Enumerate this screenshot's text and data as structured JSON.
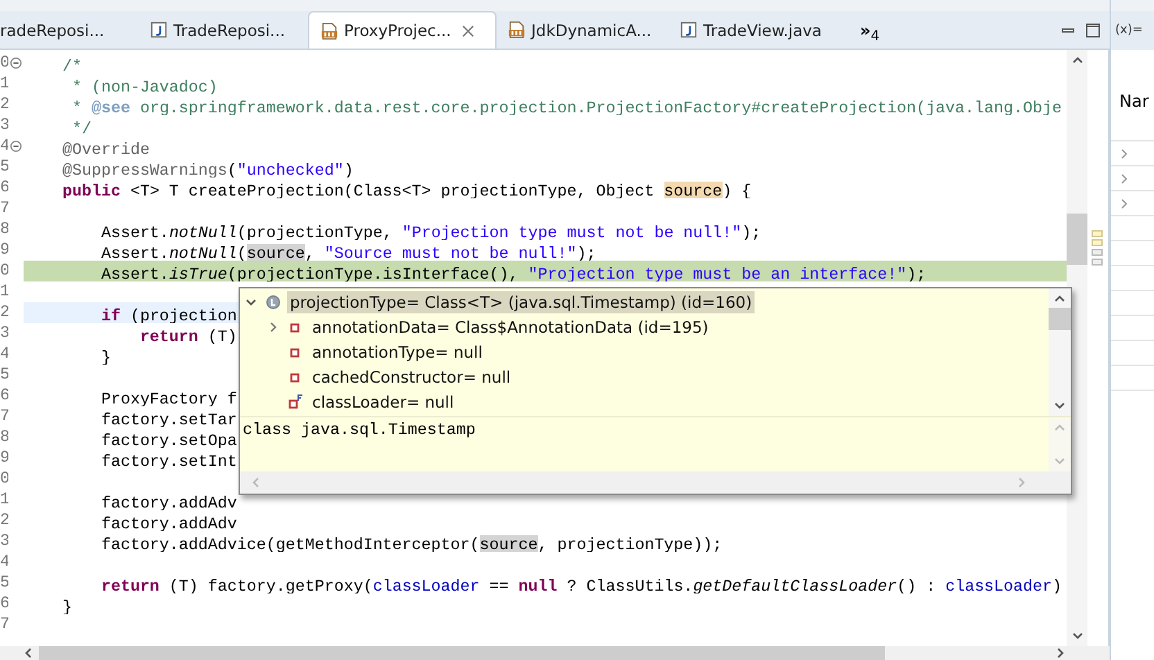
{
  "editor_tabs": [
    {
      "label": "radeReposi...",
      "kind": "cut",
      "selected": false,
      "closable": false
    },
    {
      "label": "TradeReposi...",
      "kind": "java",
      "selected": false,
      "closable": false
    },
    {
      "label": "ProxyProjec...",
      "kind": "class",
      "selected": true,
      "closable": true
    },
    {
      "label": "JdkDynamicA...",
      "kind": "class",
      "selected": false,
      "closable": false
    },
    {
      "label": "TradeView.java",
      "kind": "java",
      "selected": false,
      "closable": false
    }
  ],
  "overflow_tabs": {
    "mark": "»",
    "count": "4"
  },
  "code_lines": [
    {
      "num": "0",
      "fold": true,
      "kind": "code",
      "tokens": [
        {
          "text": "    /*",
          "kind": "comment"
        }
      ]
    },
    {
      "num": "1",
      "fold": false,
      "kind": "code",
      "tokens": [
        {
          "text": "     * (non-Javadoc)",
          "kind": "comment"
        }
      ]
    },
    {
      "num": "2",
      "fold": false,
      "kind": "code",
      "tokens": [
        {
          "text": "     * ",
          "kind": "comment"
        },
        {
          "text": "@see",
          "kind": "tag"
        },
        {
          "text": " org.springframework.data.rest.core.projection.ProjectionFactory#createProjection(java.lang.Obje",
          "kind": "comment"
        }
      ]
    },
    {
      "num": "3",
      "fold": false,
      "kind": "code",
      "tokens": [
        {
          "text": "     */",
          "kind": "comment"
        }
      ]
    },
    {
      "num": "4",
      "fold": true,
      "kind": "code",
      "tokens": [
        {
          "text": "    @Override",
          "kind": "annot"
        }
      ]
    },
    {
      "num": "5",
      "fold": false,
      "kind": "code",
      "tokens": [
        {
          "text": "    @SuppressWarnings",
          "kind": "annot"
        },
        {
          "text": "(",
          "kind": "plain"
        },
        {
          "text": "\"unchecked\"",
          "kind": "str"
        },
        {
          "text": ")",
          "kind": "plain"
        }
      ]
    },
    {
      "num": "6",
      "fold": false,
      "kind": "code",
      "tokens": [
        {
          "text": "    public",
          "kind": "kw"
        },
        {
          "text": " <T> T createProjection(Class<T> projectionType, Object ",
          "kind": "plain"
        },
        {
          "text": "source",
          "kind": "decl"
        },
        {
          "text": ") {",
          "kind": "plain"
        }
      ]
    },
    {
      "num": "7",
      "fold": false,
      "kind": "code"
    },
    {
      "num": "8",
      "fold": false,
      "kind": "code",
      "tokens": [
        {
          "text": "        Assert.",
          "kind": "plain"
        },
        {
          "text": "notNull",
          "kind": "italic"
        },
        {
          "text": "(projectionType, ",
          "kind": "plain"
        },
        {
          "text": "\"Projection type must not be null!\"",
          "kind": "str"
        },
        {
          "text": ");",
          "kind": "plain"
        }
      ]
    },
    {
      "num": "9",
      "fold": false,
      "kind": "code",
      "tokens": [
        {
          "text": "        Assert.",
          "kind": "plain"
        },
        {
          "text": "notNull",
          "kind": "italic"
        },
        {
          "text": "(",
          "kind": "plain"
        },
        {
          "text": "source",
          "kind": "occ"
        },
        {
          "text": ", ",
          "kind": "plain"
        },
        {
          "text": "\"Source must not be null!\"",
          "kind": "str"
        },
        {
          "text": ");",
          "kind": "plain"
        }
      ]
    },
    {
      "num": "0",
      "fold": false,
      "kind": "debug",
      "tokens": [
        {
          "text": "        Assert.",
          "kind": "plain"
        },
        {
          "text": "isTrue",
          "kind": "italic"
        },
        {
          "text": "(projectionType.isInterface(), ",
          "kind": "plain"
        },
        {
          "text": "\"Projection type must be an interface!\"",
          "kind": "str"
        },
        {
          "text": ");",
          "kind": "plain"
        }
      ]
    },
    {
      "num": "1",
      "fold": false,
      "kind": "code"
    },
    {
      "num": "2",
      "fold": false,
      "kind": "cursor",
      "tokens": [
        {
          "text": "        if",
          "kind": "kw"
        },
        {
          "text": " (projection",
          "kind": "plain"
        }
      ]
    },
    {
      "num": "3",
      "fold": false,
      "kind": "code",
      "tokens": [
        {
          "text": "            return",
          "kind": "kw"
        },
        {
          "text": " (T)",
          "kind": "plain"
        }
      ]
    },
    {
      "num": "4",
      "fold": false,
      "kind": "code",
      "tokens": [
        {
          "text": "        }",
          "kind": "plain"
        }
      ]
    },
    {
      "num": "5",
      "fold": false,
      "kind": "code"
    },
    {
      "num": "6",
      "fold": false,
      "kind": "code",
      "tokens": [
        {
          "text": "        ProxyFactory f",
          "kind": "plain"
        }
      ]
    },
    {
      "num": "7",
      "fold": false,
      "kind": "code",
      "tokens": [
        {
          "text": "        factory.setTar",
          "kind": "plain"
        }
      ]
    },
    {
      "num": "8",
      "fold": false,
      "kind": "code",
      "tokens": [
        {
          "text": "        factory.setOpa",
          "kind": "plain"
        }
      ]
    },
    {
      "num": "9",
      "fold": false,
      "kind": "code",
      "tokens": [
        {
          "text": "        factory.setInt",
          "kind": "plain"
        }
      ]
    },
    {
      "num": "0",
      "fold": false,
      "kind": "code"
    },
    {
      "num": "1",
      "fold": false,
      "kind": "code",
      "tokens": [
        {
          "text": "        factory.addAdv",
          "kind": "plain"
        }
      ]
    },
    {
      "num": "2",
      "fold": false,
      "kind": "code",
      "tokens": [
        {
          "text": "        factory.addAdv",
          "kind": "plain"
        }
      ]
    },
    {
      "num": "3",
      "fold": false,
      "kind": "code",
      "tokens": [
        {
          "text": "        factory.addAdvice(getMethodInterceptor(",
          "kind": "plain"
        },
        {
          "text": "source",
          "kind": "occ"
        },
        {
          "text": ", projectionType));",
          "kind": "plain"
        }
      ]
    },
    {
      "num": "4",
      "fold": false,
      "kind": "code"
    },
    {
      "num": "5",
      "fold": false,
      "kind": "code",
      "tokens": [
        {
          "text": "        return",
          "kind": "kw"
        },
        {
          "text": " (T) factory.getProxy(",
          "kind": "plain"
        },
        {
          "text": "classLoader",
          "kind": "field"
        },
        {
          "text": " == ",
          "kind": "plain"
        },
        {
          "text": "null",
          "kind": "kw"
        },
        {
          "text": " ? ClassUtils.",
          "kind": "plain"
        },
        {
          "text": "getDefaultClassLoader",
          "kind": "italic"
        },
        {
          "text": "() : ",
          "kind": "plain"
        },
        {
          "text": "classLoader",
          "kind": "field"
        },
        {
          "text": ")",
          "kind": "plain"
        }
      ]
    },
    {
      "num": "6",
      "fold": false,
      "kind": "code",
      "tokens": [
        {
          "text": "    }",
          "kind": "plain"
        }
      ]
    },
    {
      "num": "7",
      "fold": false,
      "kind": "code"
    }
  ],
  "inspect_popup": {
    "tree": [
      {
        "label": "projectionType= Class<T> (java.sql.Timestamp) (id=160)",
        "kind": "local",
        "expanded": true,
        "selected": true,
        "children": [
          {
            "label": "annotationData= Class$AnnotationData (id=195)",
            "kind": "field",
            "expanded": false,
            "selected": false
          },
          {
            "label": "annotationType= null",
            "kind": "field",
            "selected": false
          },
          {
            "label": "cachedConstructor= null",
            "kind": "field",
            "selected": false
          },
          {
            "label": "classLoader= null",
            "kind": "final_field",
            "selected": false
          }
        ]
      }
    ],
    "detail": "class java.sql.Timestamp"
  },
  "variables_view": {
    "tab_label": "(x)=",
    "column_header": "Nar"
  }
}
